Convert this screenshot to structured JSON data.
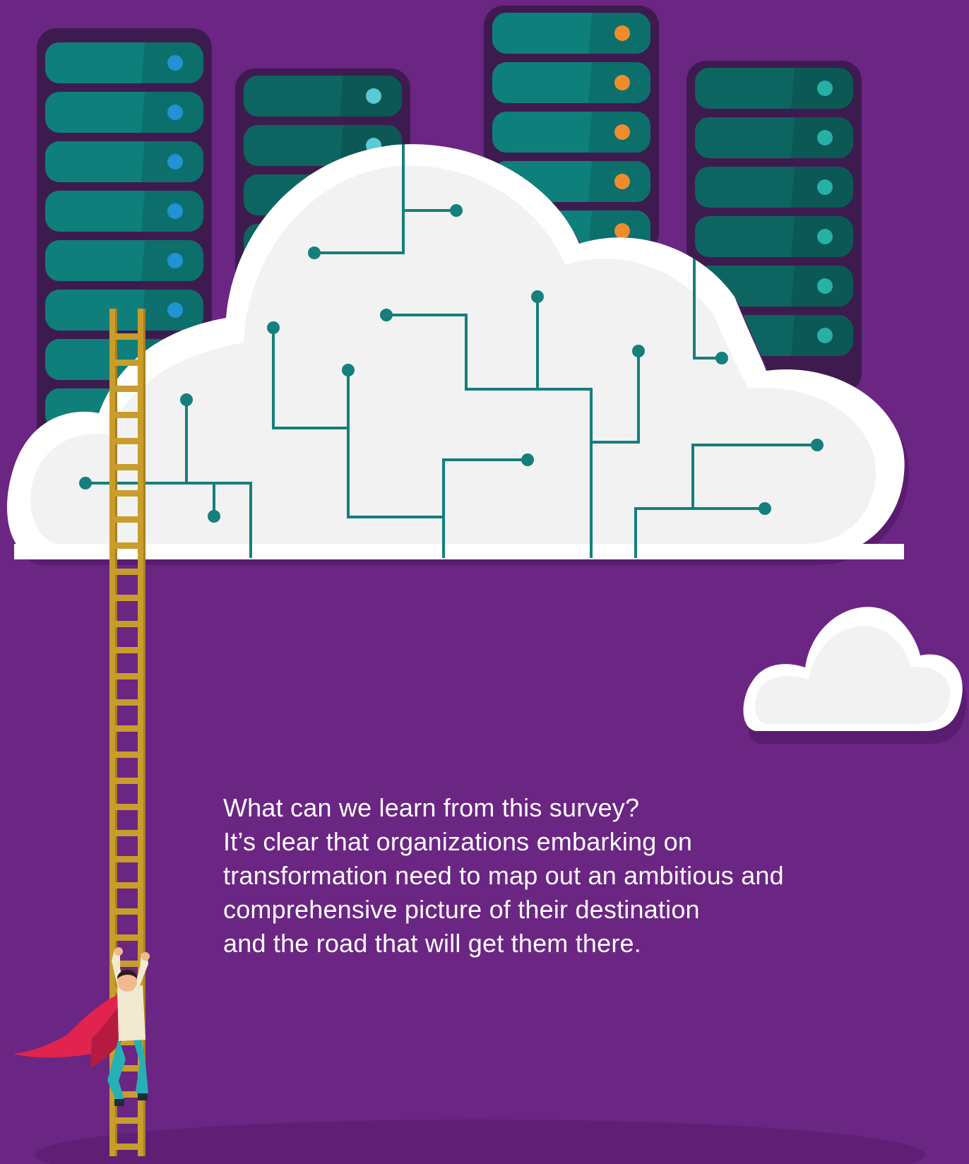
{
  "colors": {
    "background": "#6b2583",
    "rack_frame": "#3e1b4f",
    "rack_unit": "#0f7f7b",
    "rack_unit_dark": "#0d6561",
    "led_blue": "#1f93d3",
    "led_orange": "#ef8d2c",
    "led_teal": "#26b0a6",
    "cloud_fill": "#f2f2f2",
    "cloud_outline": "#ffffff",
    "circuit": "#157f7b",
    "ladder": "#c89d2c",
    "cape": "#e0244f",
    "text": "#ffffff"
  },
  "icons": {
    "server_racks": "server-rack-icon",
    "cloud": "cloud-icon",
    "ladder": "ladder-icon",
    "person": "superhero-climber-icon"
  },
  "caption": {
    "lines": [
      "What can we learn from this survey?",
      "It’s clear that organizations embarking on",
      "transformation need to map out an ambitious and",
      "comprehensive picture of their destination",
      "and the road that will get them there."
    ]
  }
}
